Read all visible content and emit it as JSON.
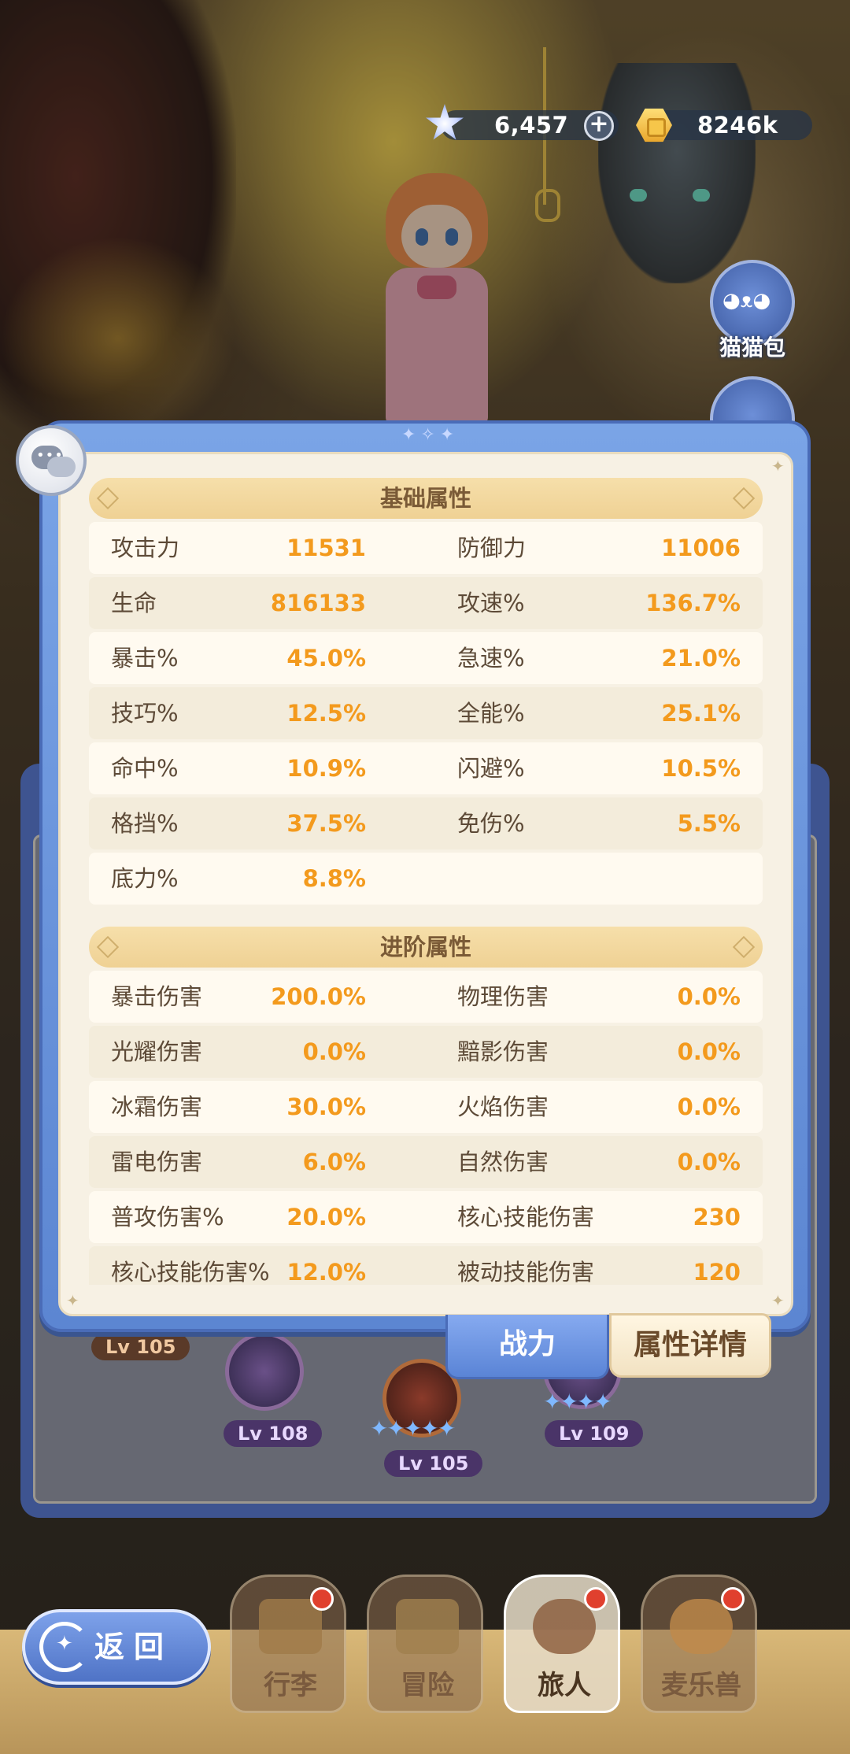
{
  "currency": {
    "gems": "6,457",
    "gold": "8246k"
  },
  "side": {
    "cat_bag_label": "猫猫包"
  },
  "basic": {
    "title": "基础属性",
    "rows": [
      [
        {
          "name": "攻击力",
          "value": "11531"
        },
        {
          "name": "防御力",
          "value": "11006"
        }
      ],
      [
        {
          "name": "生命",
          "value": "816133"
        },
        {
          "name": "攻速%",
          "value": "136.7%"
        }
      ],
      [
        {
          "name": "暴击%",
          "value": "45.0%"
        },
        {
          "name": "急速%",
          "value": "21.0%"
        }
      ],
      [
        {
          "name": "技巧%",
          "value": "12.5%"
        },
        {
          "name": "全能%",
          "value": "25.1%"
        }
      ],
      [
        {
          "name": "命中%",
          "value": "10.9%"
        },
        {
          "name": "闪避%",
          "value": "10.5%"
        }
      ],
      [
        {
          "name": "格挡%",
          "value": "37.5%"
        },
        {
          "name": "免伤%",
          "value": "5.5%"
        }
      ],
      [
        {
          "name": "底力%",
          "value": "8.8%"
        },
        {
          "name": "",
          "value": ""
        }
      ]
    ]
  },
  "advanced": {
    "title": "进阶属性",
    "rows": [
      [
        {
          "name": "暴击伤害",
          "value": "200.0%"
        },
        {
          "name": "物理伤害",
          "value": "0.0%"
        }
      ],
      [
        {
          "name": "光耀伤害",
          "value": "0.0%"
        },
        {
          "name": "黯影伤害",
          "value": "0.0%"
        }
      ],
      [
        {
          "name": "冰霜伤害",
          "value": "30.0%"
        },
        {
          "name": "火焰伤害",
          "value": "0.0%"
        }
      ],
      [
        {
          "name": "雷电伤害",
          "value": "6.0%"
        },
        {
          "name": "自然伤害",
          "value": "0.0%"
        }
      ],
      [
        {
          "name": "普攻伤害%",
          "value": "20.0%"
        },
        {
          "name": "核心技能伤害",
          "value": "230"
        }
      ],
      [
        {
          "name": "核心技能伤害%",
          "value": "12.0%"
        },
        {
          "name": "被动技能伤害",
          "value": "120"
        }
      ]
    ]
  },
  "tabs": {
    "power": "战力",
    "detail": "属性详情"
  },
  "team": {
    "lv_a": "Lv 105",
    "lv_b": "Lv 108",
    "lv_c": "Lv 105",
    "lv_d": "Lv 109"
  },
  "nav": {
    "items": [
      {
        "label": "行李"
      },
      {
        "label": "冒险"
      },
      {
        "label": "旅人"
      },
      {
        "label": "麦乐兽"
      }
    ],
    "back_label": "返回"
  },
  "colors": {
    "stat_value": "#f39a1d",
    "stat_name": "#5d4a37",
    "panel_blue": "#6e97df",
    "panel_cream": "#f7f1e4",
    "header_gold": "#f0d49a"
  }
}
